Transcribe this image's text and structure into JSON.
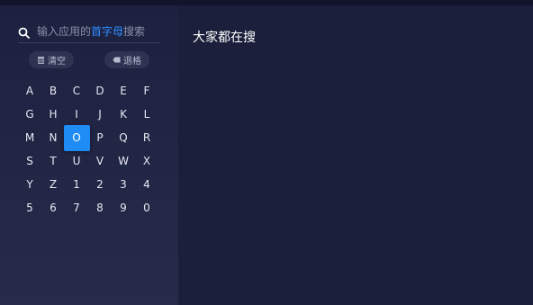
{
  "search": {
    "hint_prefix": "输入应用的",
    "hint_highlight": "首字母",
    "hint_suffix": "搜索"
  },
  "actions": {
    "clear_label": "清空",
    "backspace_label": "退格"
  },
  "keyboard": {
    "keys": [
      "A",
      "B",
      "C",
      "D",
      "E",
      "F",
      "G",
      "H",
      "I",
      "J",
      "K",
      "L",
      "M",
      "N",
      "O",
      "P",
      "Q",
      "R",
      "S",
      "T",
      "U",
      "V",
      "W",
      "X",
      "Y",
      "Z",
      "1",
      "2",
      "3",
      "4",
      "5",
      "6",
      "7",
      "8",
      "9",
      "0"
    ],
    "selected_key": "O"
  },
  "popular": {
    "title": "大家都在搜"
  },
  "colors": {
    "accent": "#1f8cf5",
    "highlight_text": "#2f8cff",
    "background": "#1b1f3b"
  },
  "icons": {
    "search": "search-icon",
    "clear": "trash-icon",
    "backspace": "backspace-icon"
  }
}
